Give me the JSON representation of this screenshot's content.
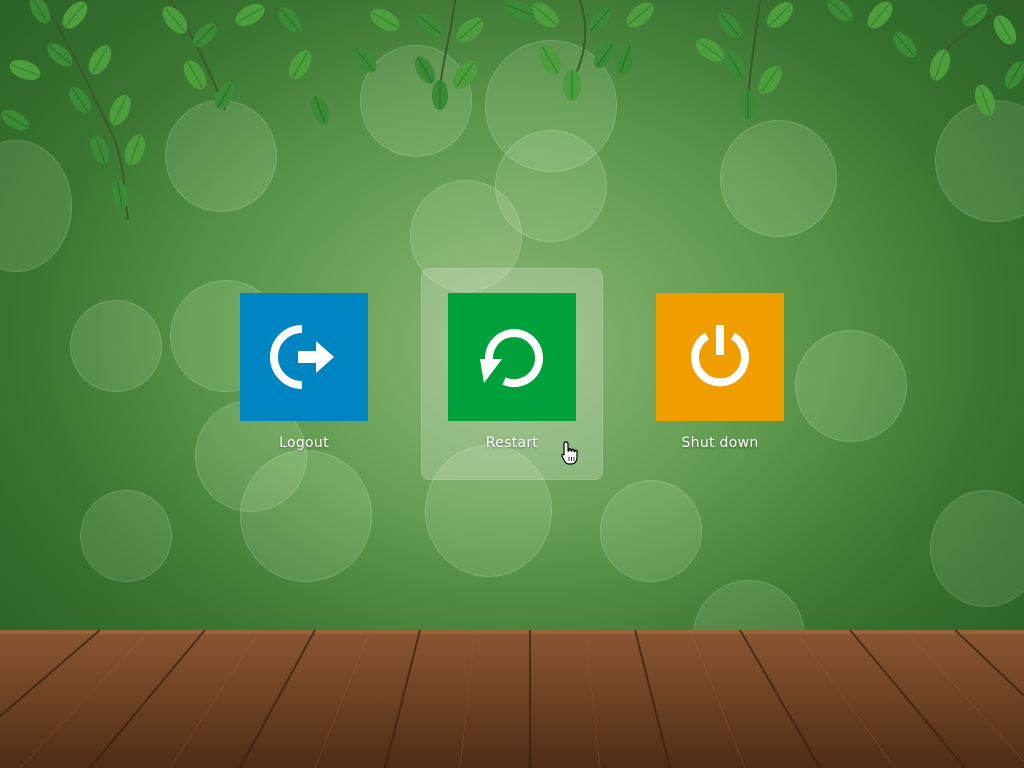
{
  "actions": [
    {
      "id": "logout",
      "label": "Logout",
      "color": "#0085c3",
      "icon": "logout-icon"
    },
    {
      "id": "restart",
      "label": "Restart",
      "color": "#00a13a",
      "icon": "restart-icon"
    },
    {
      "id": "shutdown",
      "label": "Shut down",
      "color": "#f09d00",
      "icon": "power-icon"
    }
  ],
  "hovered_action": "restart",
  "background": {
    "upper": "blurred green foliage with leaves",
    "floor": "wooden planks"
  }
}
